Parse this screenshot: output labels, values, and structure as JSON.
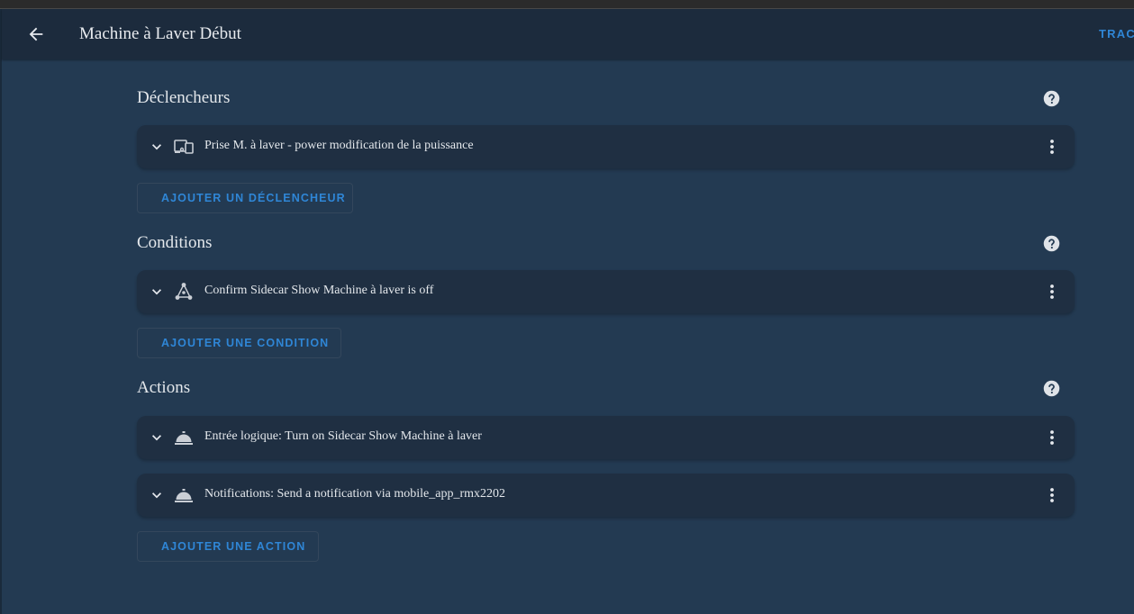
{
  "header": {
    "title": "Machine à Laver Début",
    "traces_label": "TRACES"
  },
  "sections": {
    "triggers": {
      "title": "Déclencheurs",
      "items": [
        {
          "label": "Prise M. à laver - power modification de la puissance",
          "icon": "device-icon"
        }
      ],
      "add_label": "AJOUTER UN DÉCLENCHEUR"
    },
    "conditions": {
      "title": "Conditions",
      "items": [
        {
          "label": "Confirm Sidecar Show Machine à laver is off",
          "icon": "state-graph-icon"
        }
      ],
      "add_label": "AJOUTER UNE CONDITION"
    },
    "actions": {
      "title": "Actions",
      "items": [
        {
          "label": "Entrée logique: Turn on Sidecar Show Machine à laver",
          "icon": "service-bell-icon"
        },
        {
          "label": "Notifications: Send a notification via mobile_app_rmx2202",
          "icon": "service-bell-icon"
        }
      ],
      "add_label": "AJOUTER UNE ACTION"
    }
  },
  "colors": {
    "background": "#233a52",
    "appbar": "#1c2b3d",
    "card": "#1f2f42",
    "accent": "#2f86d6"
  }
}
